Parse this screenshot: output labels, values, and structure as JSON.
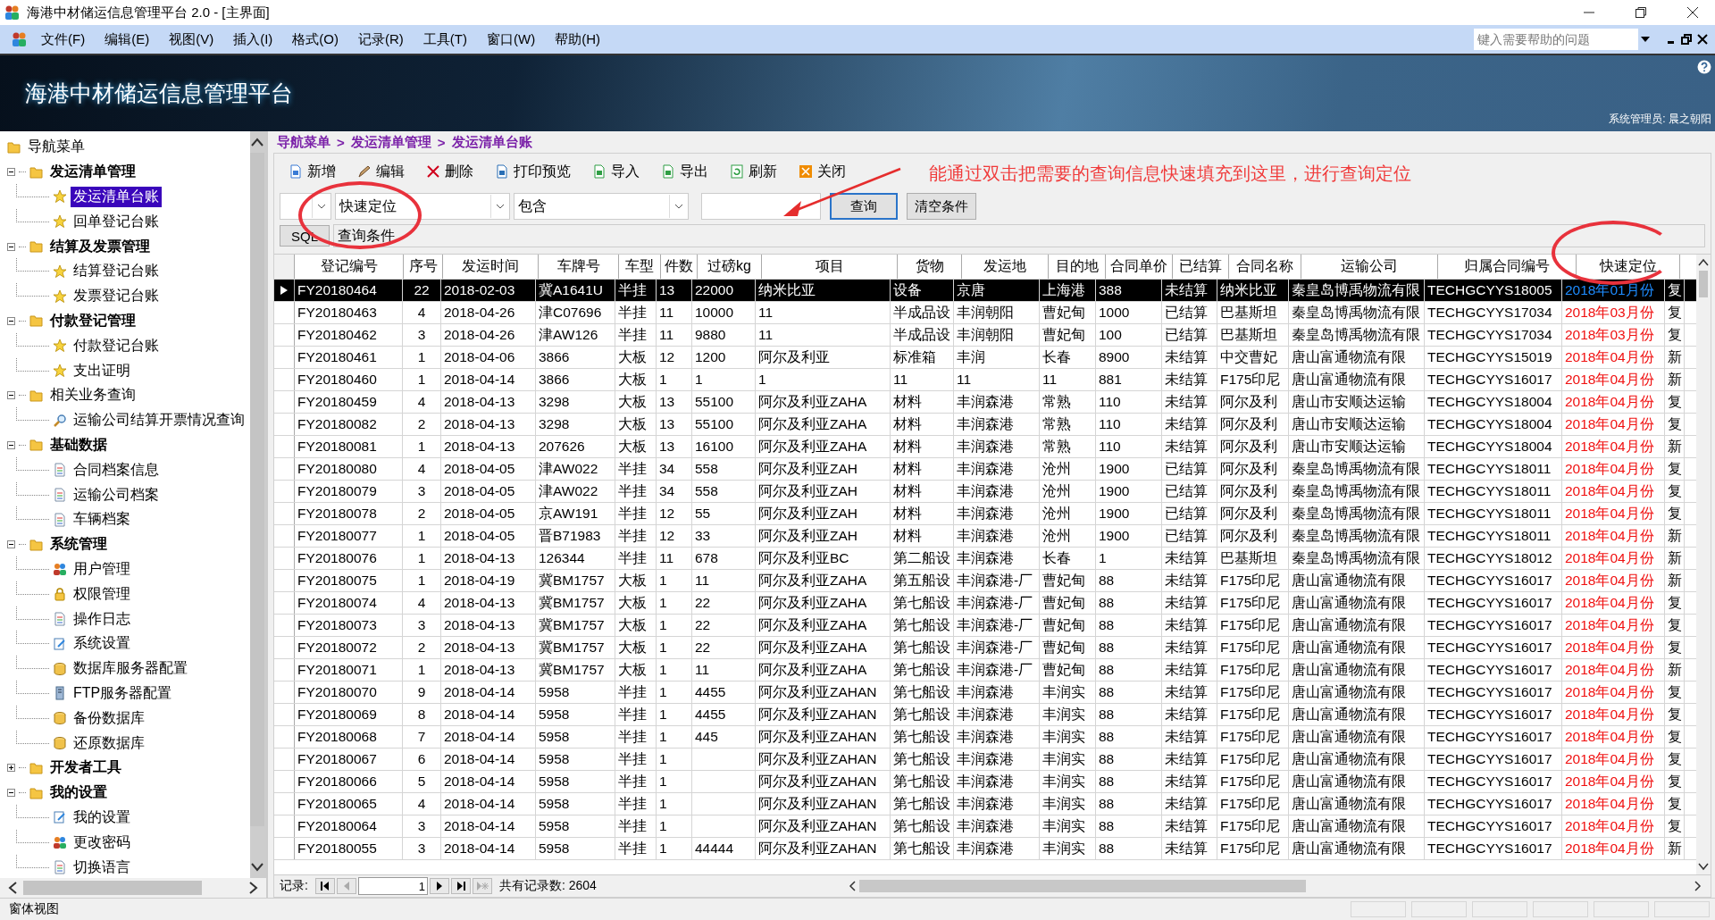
{
  "window": {
    "title": "海港中材储运信息管理平台 2.0 - [主界面]"
  },
  "menu": [
    "文件(F)",
    "编辑(E)",
    "视图(V)",
    "插入(I)",
    "格式(O)",
    "记录(R)",
    "工具(T)",
    "窗口(W)",
    "帮助(H)"
  ],
  "help_search": {
    "placeholder": "键入需要帮助的问题"
  },
  "banner": {
    "title": "海港中材储运信息管理平台",
    "user": "系统管理员: 晨之朝阳"
  },
  "nav": {
    "title": "导航菜单",
    "groups": [
      {
        "label": "发运清单管理",
        "bold": true,
        "expanded": true,
        "children": [
          {
            "label": "发运清单台账",
            "kind": "star",
            "selected": true
          },
          {
            "label": "回单登记台账",
            "kind": "star",
            "selected": false
          }
        ]
      },
      {
        "label": "结算及发票管理",
        "bold": true,
        "expanded": true,
        "children": [
          {
            "label": "结算登记台账",
            "kind": "star",
            "selected": false
          },
          {
            "label": "发票登记台账",
            "kind": "star",
            "selected": false
          }
        ]
      },
      {
        "label": "付款登记管理",
        "bold": true,
        "expanded": true,
        "children": [
          {
            "label": "付款登记台账",
            "kind": "star",
            "selected": false
          },
          {
            "label": "支出证明",
            "kind": "star",
            "selected": false
          }
        ]
      },
      {
        "label": "相关业务查询",
        "bold": false,
        "expanded": true,
        "children": [
          {
            "label": "运输公司结算开票情况查询",
            "kind": "search",
            "selected": false
          }
        ]
      },
      {
        "label": "基础数据",
        "bold": true,
        "expanded": true,
        "children": [
          {
            "label": "合同档案信息",
            "kind": "doc",
            "selected": false
          },
          {
            "label": "运输公司档案",
            "kind": "doc",
            "selected": false
          },
          {
            "label": "车辆档案",
            "kind": "doc",
            "selected": false
          }
        ]
      },
      {
        "label": "系统管理",
        "bold": true,
        "expanded": true,
        "children": [
          {
            "label": "用户管理",
            "kind": "users",
            "selected": false
          },
          {
            "label": "权限管理",
            "kind": "lock",
            "selected": false
          },
          {
            "label": "操作日志",
            "kind": "doc",
            "selected": false
          },
          {
            "label": "系统设置",
            "kind": "settings",
            "selected": false
          },
          {
            "label": "数据库服务器配置",
            "kind": "db",
            "selected": false
          },
          {
            "label": "FTP服务器配置",
            "kind": "server",
            "selected": false
          },
          {
            "label": "备份数据库",
            "kind": "db",
            "selected": false
          },
          {
            "label": "还原数据库",
            "kind": "db",
            "selected": false
          }
        ]
      },
      {
        "label": "开发者工具",
        "bold": true,
        "expanded": false
      },
      {
        "label": "我的设置",
        "bold": true,
        "expanded": true,
        "children": [
          {
            "label": "我的设置",
            "kind": "settings",
            "selected": false
          },
          {
            "label": "更改密码",
            "kind": "users",
            "selected": false
          },
          {
            "label": "切换语言",
            "kind": "doc",
            "selected": false
          }
        ]
      }
    ]
  },
  "breadcrumb": [
    "导航菜单",
    ">",
    "发运清单管理",
    ">",
    "发运清单台账"
  ],
  "toolbar": [
    {
      "label": "新增",
      "kind": "new"
    },
    {
      "label": "编辑",
      "kind": "edit"
    },
    {
      "label": "删除",
      "kind": "delete"
    },
    {
      "label": "打印预览",
      "kind": "print"
    },
    {
      "label": "导入",
      "kind": "import"
    },
    {
      "label": "导出",
      "kind": "export"
    },
    {
      "label": "刷新",
      "kind": "refresh"
    },
    {
      "label": "关闭",
      "kind": "close"
    }
  ],
  "query": {
    "field": "快速定位",
    "operator": "包含",
    "search_button": "查询",
    "clear_button": "清空条件",
    "sql_button": "SQL",
    "condition_label": "查询条件"
  },
  "annotation": "能通过双击把需要的查询信息快速填充到这里，进行查询定位",
  "table": {
    "columns": [
      "登记编号",
      "序号",
      "发运时间",
      "车牌号",
      "车型",
      "件数",
      "过磅kg",
      "项目",
      "货物",
      "发运地",
      "目的地",
      "合同单价",
      "已结算",
      "合同名称",
      "运输公司",
      "归属合同编号",
      "快速定位"
    ],
    "rows": [
      {
        "selected": true,
        "cells": [
          "FY20180464",
          "22",
          "2018-02-03",
          "冀A1641U",
          "半挂",
          "13",
          "22000",
          "纳米比亚",
          "设备",
          "京唐",
          "上海港",
          "388",
          "未结算",
          "纳米比亚",
          "秦皇岛博禹物流有限",
          "TECHGCYYS18005",
          "2018年01月份",
          "复"
        ]
      },
      {
        "selected": false,
        "cells": [
          "FY20180463",
          "4",
          "2018-04-26",
          "津C07696",
          "半挂",
          "11",
          "10000",
          "11",
          "半成品设",
          "丰润朝阳",
          "曹妃甸",
          "1000",
          "已结算",
          "巴基斯坦",
          "秦皇岛博禹物流有限",
          "TECHGCYYS17034",
          "2018年03月份",
          "复"
        ]
      },
      {
        "selected": false,
        "cells": [
          "FY20180462",
          "3",
          "2018-04-26",
          "津AW126",
          "半挂",
          "11",
          "9880",
          "11",
          "半成品设",
          "丰润朝阳",
          "曹妃甸",
          "100",
          "已结算",
          "巴基斯坦",
          "秦皇岛博禹物流有限",
          "TECHGCYYS17034",
          "2018年03月份",
          "复"
        ]
      },
      {
        "selected": false,
        "cells": [
          "FY20180461",
          "1",
          "2018-04-06",
          "3866",
          "大板",
          "12",
          "1200",
          "阿尔及利亚",
          "标准箱",
          "丰润",
          "长春",
          "8900",
          "未结算",
          "中交曹妃",
          "唐山富通物流有限",
          "TECHGCYYS15019",
          "2018年04月份",
          "新"
        ]
      },
      {
        "selected": false,
        "cells": [
          "FY20180460",
          "1",
          "2018-04-14",
          "3866",
          "大板",
          "1",
          "1",
          "1",
          "11",
          "11",
          "11",
          "881",
          "未结算",
          "F175印尼",
          "唐山富通物流有限",
          "TECHGCYYS16017",
          "2018年04月份",
          "新"
        ]
      },
      {
        "selected": false,
        "cells": [
          "FY20180459",
          "4",
          "2018-04-13",
          "3298",
          "大板",
          "13",
          "55100",
          "阿尔及利亚ZAHA",
          "材料",
          "丰润森港",
          "常熟",
          "110",
          "未结算",
          "阿尔及利",
          "唐山市安顺达运输",
          "TECHGCYYS18004",
          "2018年04月份",
          "复"
        ]
      },
      {
        "selected": false,
        "cells": [
          "FY20180082",
          "2",
          "2018-04-13",
          "3298",
          "大板",
          "13",
          "55100",
          "阿尔及利亚ZAHA",
          "材料",
          "丰润森港",
          "常熟",
          "110",
          "未结算",
          "阿尔及利",
          "唐山市安顺达运输",
          "TECHGCYYS18004",
          "2018年04月份",
          "复"
        ]
      },
      {
        "selected": false,
        "cells": [
          "FY20180081",
          "1",
          "2018-04-13",
          "207626",
          "大板",
          "13",
          "16100",
          "阿尔及利亚ZAHA",
          "材料",
          "丰润森港",
          "常熟",
          "110",
          "未结算",
          "阿尔及利",
          "唐山市安顺达运输",
          "TECHGCYYS18004",
          "2018年04月份",
          "新"
        ]
      },
      {
        "selected": false,
        "cells": [
          "FY20180080",
          "4",
          "2018-04-05",
          "津AW022",
          "半挂",
          "34",
          "558",
          "阿尔及利亚ZAH",
          "材料",
          "丰润森港",
          "沧州",
          "1900",
          "已结算",
          "阿尔及利",
          "秦皇岛博禹物流有限",
          "TECHGCYYS18011",
          "2018年04月份",
          "复"
        ]
      },
      {
        "selected": false,
        "cells": [
          "FY20180079",
          "3",
          "2018-04-05",
          "津AW022",
          "半挂",
          "34",
          "558",
          "阿尔及利亚ZAH",
          "材料",
          "丰润森港",
          "沧州",
          "1900",
          "已结算",
          "阿尔及利",
          "秦皇岛博禹物流有限",
          "TECHGCYYS18011",
          "2018年04月份",
          "复"
        ]
      },
      {
        "selected": false,
        "cells": [
          "FY20180078",
          "2",
          "2018-04-05",
          "京AW191",
          "半挂",
          "12",
          "55",
          "阿尔及利亚ZAH",
          "材料",
          "丰润森港",
          "沧州",
          "1900",
          "已结算",
          "阿尔及利",
          "秦皇岛博禹物流有限",
          "TECHGCYYS18011",
          "2018年04月份",
          "复"
        ]
      },
      {
        "selected": false,
        "cells": [
          "FY20180077",
          "1",
          "2018-04-05",
          "晋B71983",
          "半挂",
          "12",
          "33",
          "阿尔及利亚ZAH",
          "材料",
          "丰润森港",
          "沧州",
          "1900",
          "已结算",
          "阿尔及利",
          "秦皇岛博禹物流有限",
          "TECHGCYYS18011",
          "2018年04月份",
          "新"
        ]
      },
      {
        "selected": false,
        "cells": [
          "FY20180076",
          "1",
          "2018-04-13",
          "126344",
          "半挂",
          "11",
          "678",
          "阿尔及利亚BC",
          "第二船设",
          "丰润森港",
          "长春",
          "1",
          "未结算",
          "巴基斯坦",
          "秦皇岛博禹物流有限",
          "TECHGCYYS18012",
          "2018年04月份",
          "新"
        ]
      },
      {
        "selected": false,
        "cells": [
          "FY20180075",
          "1",
          "2018-04-19",
          "冀BM1757",
          "大板",
          "1",
          "11",
          "阿尔及利亚ZAHA",
          "第五船设",
          "丰润森港-厂",
          "曹妃甸",
          "88",
          "未结算",
          "F175印尼",
          "唐山富通物流有限",
          "TECHGCYYS16017",
          "2018年04月份",
          "新"
        ]
      },
      {
        "selected": false,
        "cells": [
          "FY20180074",
          "4",
          "2018-04-13",
          "冀BM1757",
          "大板",
          "1",
          "22",
          "阿尔及利亚ZAHA",
          "第七船设",
          "丰润森港-厂",
          "曹妃甸",
          "88",
          "未结算",
          "F175印尼",
          "唐山富通物流有限",
          "TECHGCYYS16017",
          "2018年04月份",
          "复"
        ]
      },
      {
        "selected": false,
        "cells": [
          "FY20180073",
          "3",
          "2018-04-13",
          "冀BM1757",
          "大板",
          "1",
          "22",
          "阿尔及利亚ZAHA",
          "第七船设",
          "丰润森港-厂",
          "曹妃甸",
          "88",
          "未结算",
          "F175印尼",
          "唐山富通物流有限",
          "TECHGCYYS16017",
          "2018年04月份",
          "复"
        ]
      },
      {
        "selected": false,
        "cells": [
          "FY20180072",
          "2",
          "2018-04-13",
          "冀BM1757",
          "大板",
          "1",
          "22",
          "阿尔及利亚ZAHA",
          "第七船设",
          "丰润森港-厂",
          "曹妃甸",
          "88",
          "未结算",
          "F175印尼",
          "唐山富通物流有限",
          "TECHGCYYS16017",
          "2018年04月份",
          "复"
        ]
      },
      {
        "selected": false,
        "cells": [
          "FY20180071",
          "1",
          "2018-04-13",
          "冀BM1757",
          "大板",
          "1",
          "11",
          "阿尔及利亚ZAHA",
          "第七船设",
          "丰润森港-厂",
          "曹妃甸",
          "88",
          "未结算",
          "F175印尼",
          "唐山富通物流有限",
          "TECHGCYYS16017",
          "2018年04月份",
          "新"
        ]
      },
      {
        "selected": false,
        "cells": [
          "FY20180070",
          "9",
          "2018-04-14",
          "5958",
          "半挂",
          "1",
          "4455",
          "阿尔及利亚ZAHAN",
          "第七船设",
          "丰润森港",
          "丰润实",
          "88",
          "未结算",
          "F175印尼",
          "唐山富通物流有限",
          "TECHGCYYS16017",
          "2018年04月份",
          "复"
        ]
      },
      {
        "selected": false,
        "cells": [
          "FY20180069",
          "8",
          "2018-04-14",
          "5958",
          "半挂",
          "1",
          "4455",
          "阿尔及利亚ZAHAN",
          "第七船设",
          "丰润森港",
          "丰润实",
          "88",
          "未结算",
          "F175印尼",
          "唐山富通物流有限",
          "TECHGCYYS16017",
          "2018年04月份",
          "复"
        ]
      },
      {
        "selected": false,
        "cells": [
          "FY20180068",
          "7",
          "2018-04-14",
          "5958",
          "半挂",
          "1",
          "445",
          "阿尔及利亚ZAHAN",
          "第七船设",
          "丰润森港",
          "丰润实",
          "88",
          "未结算",
          "F175印尼",
          "唐山富通物流有限",
          "TECHGCYYS16017",
          "2018年04月份",
          "复"
        ]
      },
      {
        "selected": false,
        "cells": [
          "FY20180067",
          "6",
          "2018-04-14",
          "5958",
          "半挂",
          "1",
          null,
          "阿尔及利亚ZAHAN",
          "第七船设",
          "丰润森港",
          "丰润实",
          "88",
          "未结算",
          "F175印尼",
          "唐山富通物流有限",
          "TECHGCYYS16017",
          "2018年04月份",
          "复"
        ]
      },
      {
        "selected": false,
        "cells": [
          "FY20180066",
          "5",
          "2018-04-14",
          "5958",
          "半挂",
          "1",
          null,
          "阿尔及利亚ZAHAN",
          "第七船设",
          "丰润森港",
          "丰润实",
          "88",
          "未结算",
          "F175印尼",
          "唐山富通物流有限",
          "TECHGCYYS16017",
          "2018年04月份",
          "复"
        ]
      },
      {
        "selected": false,
        "cells": [
          "FY20180065",
          "4",
          "2018-04-14",
          "5958",
          "半挂",
          "1",
          null,
          "阿尔及利亚ZAHAN",
          "第七船设",
          "丰润森港",
          "丰润实",
          "88",
          "未结算",
          "F175印尼",
          "唐山富通物流有限",
          "TECHGCYYS16017",
          "2018年04月份",
          "复"
        ]
      },
      {
        "selected": false,
        "cells": [
          "FY20180064",
          "3",
          "2018-04-14",
          "5958",
          "半挂",
          "1",
          null,
          "阿尔及利亚ZAHAN",
          "第七船设",
          "丰润森港",
          "丰润实",
          "88",
          "未结算",
          "F175印尼",
          "唐山富通物流有限",
          "TECHGCYYS16017",
          "2018年04月份",
          "复"
        ]
      },
      {
        "selected": false,
        "cells": [
          "FY20180055",
          "3",
          "2018-04-14",
          "5958",
          "半挂",
          "1",
          "44444",
          "阿尔及利亚ZAHAN",
          "第七船设",
          "丰润森港",
          "丰润实",
          "88",
          "未结算",
          "F175印尼",
          "唐山富通物流有限",
          "TECHGCYYS16017",
          "2018年04月份",
          "新"
        ]
      }
    ]
  },
  "record_nav": {
    "label": "记录:",
    "current": "1",
    "total": "共有记录数: 2604"
  },
  "status_bar": "窗体视图"
}
